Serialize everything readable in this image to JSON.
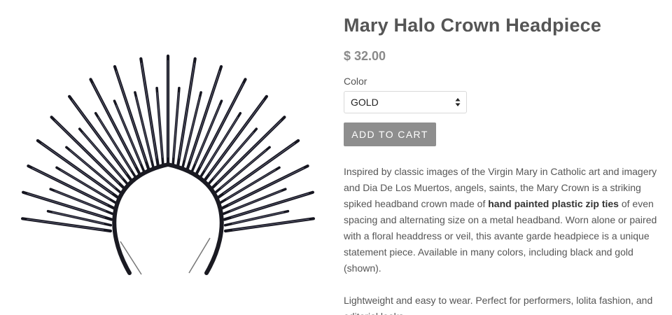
{
  "product": {
    "title": "Mary Halo Crown Headpiece",
    "price": "$ 32.00",
    "image_alt": "Black spiked zip tie halo crown on a headband"
  },
  "options": {
    "color_label": "Color",
    "color_selected": "GOLD"
  },
  "actions": {
    "add_to_cart_label": "ADD TO CART"
  },
  "description": {
    "p1_before": "Inspired by classic images of the Virgin Mary in Catholic art and imagery and Dia De Los Muertos, angels, saints, the Mary Crown is a striking spiked headband crown made of ",
    "p1_bold": "hand painted plastic zip ties",
    "p1_after": " of even spacing and alternating size on a metal headband. Worn alone or paired with a floral headdress or veil, this avante garde headpiece is a unique statement piece. Available in many colors, including black and gold (shown).",
    "p2": "Lightweight and easy to wear. Perfect for performers, lolita fashion, and editorial looks."
  },
  "colors": {
    "title": "#555555",
    "price": "#8a8a8a",
    "button_bg": "#8e8e8e",
    "spike": "#161620"
  }
}
